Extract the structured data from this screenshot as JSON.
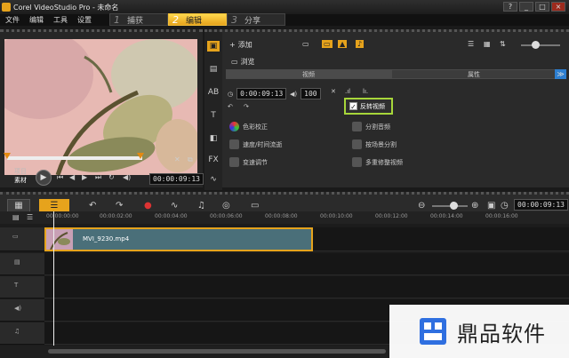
{
  "window": {
    "title": "Corel VideoStudio Pro - 未命名",
    "controls": [
      "?",
      "_",
      "□",
      "×"
    ]
  },
  "menu": [
    "文件",
    "编辑",
    "工具",
    "设置"
  ],
  "steps": [
    {
      "num": "1",
      "label": "捕获"
    },
    {
      "num": "2",
      "label": "编辑"
    },
    {
      "num": "3",
      "label": "分享"
    }
  ],
  "preview": {
    "mode_project": "项目",
    "mode_clip": "素材",
    "timecode": "00:00:09:13"
  },
  "library": {
    "add_label": "添加",
    "browse_label": "浏览"
  },
  "options": {
    "tab_video": "视频",
    "tab_attributes": "属性",
    "duration": "0:00:09:13",
    "volume": "100",
    "reverse_video": "反转视频",
    "color_correction": "色彩校正",
    "speed_remap": "速度/时间流逝",
    "variable_speed": "变速调节",
    "split_audio": "分割音频",
    "split_by_scene": "按场景分割",
    "multi_trim": "多重修整视频"
  },
  "timeline": {
    "timecode": "00:00:09:13",
    "ruler": [
      "00:00:00:00",
      "00:00:02:00",
      "00:00:04:00",
      "00:00:06:00",
      "00:00:08:00",
      "00:00:10:00",
      "00:00:12:00",
      "00:00:14:00",
      "00:00:16:00"
    ],
    "clip_name": "MVI_9230.mp4"
  },
  "watermark": {
    "text": "鼎品软件"
  },
  "colors": {
    "accent": "#e6a31c",
    "highlight": "#a7d63a",
    "clip": "#4a6f79"
  }
}
